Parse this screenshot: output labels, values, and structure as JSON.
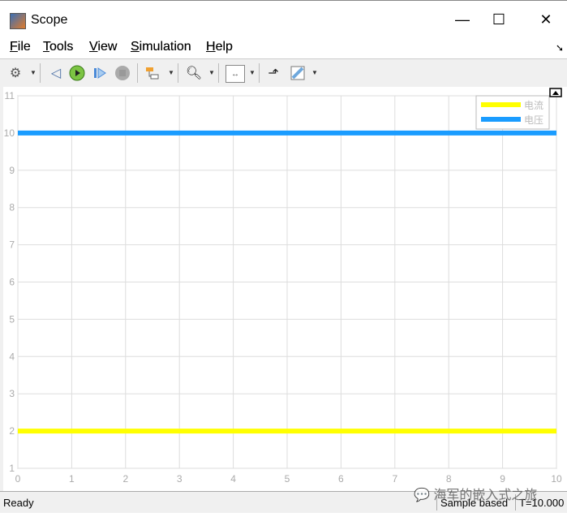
{
  "window": {
    "title": "Scope",
    "minimize": "—",
    "maximize": "☐",
    "close": "✕"
  },
  "menu": [
    {
      "label": "File",
      "mn": "F",
      "rest": "ile"
    },
    {
      "label": "Tools",
      "mn": "T",
      "rest": "ools"
    },
    {
      "label": "View",
      "mn": "V",
      "rest": "iew"
    },
    {
      "label": "Simulation",
      "mn": "S",
      "rest": "imulation"
    },
    {
      "label": "Help",
      "mn": "H",
      "rest": "elp"
    }
  ],
  "toolbar": [
    "settings-icon",
    "step-back-icon",
    "run-icon",
    "step-forward-icon",
    "stop-icon",
    "signal-selector-icon",
    "zoom-in-icon",
    "fit-axes-icon",
    "triggers-icon",
    "measurement-ruler-icon"
  ],
  "chart_data": {
    "type": "line",
    "xlim": [
      0,
      10
    ],
    "ylim": [
      1,
      11
    ],
    "xticks": [
      "0",
      "1",
      "2",
      "3",
      "4",
      "5",
      "6",
      "7",
      "8",
      "9",
      "10"
    ],
    "yticks": [
      "1",
      "2",
      "3",
      "4",
      "5",
      "6",
      "7",
      "8",
      "9",
      "10",
      "11"
    ],
    "grid": true,
    "legend_position": "top-right",
    "series": [
      {
        "name": "电流",
        "color": "#ffff00",
        "x": [
          0,
          10
        ],
        "y": [
          2,
          2
        ]
      },
      {
        "name": "电压",
        "color": "#1a9cff",
        "x": [
          0,
          10
        ],
        "y": [
          10,
          10
        ]
      }
    ]
  },
  "status": {
    "ready": "Ready",
    "mode": "Sample based",
    "time": "T=10.000"
  },
  "watermark": "海军的嵌入式之旅"
}
